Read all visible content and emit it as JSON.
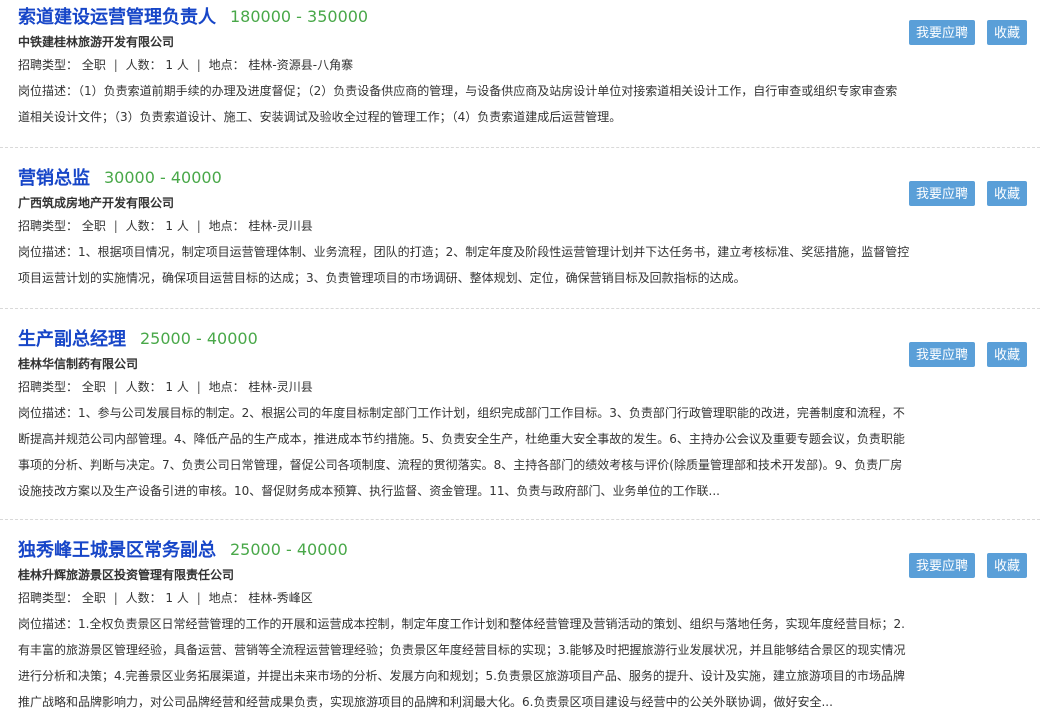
{
  "jobs": [
    {
      "title": "索道建设运营管理负责人",
      "salary": "180000 - 350000",
      "company": "中铁建桂林旅游开发有限公司",
      "type_label": "招聘类型：",
      "type": "全职",
      "count_label": "人数：",
      "count": "1 人",
      "location_label": "地点：",
      "location": "桂林-资源县-八角寨",
      "desc_label": "岗位描述：",
      "desc_lines": [
        "（1）负责索道前期手续的办理及进度督促；（2）负责设备供应商的管理，与设备供应商及站房设计单位对接索道相关设计工作，自行审查或组织专家审查索",
        "道相关设计文件；（3）负责索道设计、施工、安装调试及验收全过程的管理工作；（4）负责索道建成后运营管理。"
      ],
      "apply_label": "我要应聘",
      "fav_label": "收藏"
    },
    {
      "title": "营销总监",
      "salary": "30000 - 40000",
      "company": "广西筑成房地产开发有限公司",
      "type_label": "招聘类型：",
      "type": "全职",
      "count_label": "人数：",
      "count": "1 人",
      "location_label": "地点：",
      "location": "桂林-灵川县",
      "desc_label": "岗位描述：",
      "desc_lines": [
        "1、根据项目情况，制定项目运营管理体制、业务流程，团队的打造；2、制定年度及阶段性运营管理计划并下达任务书，建立考核标准、奖惩措施，监督管控",
        "项目运营计划的实施情况，确保项目运营目标的达成；3、负责管理项目的市场调研、整体规划、定位，确保营销目标及回款指标的达成。"
      ],
      "apply_label": "我要应聘",
      "fav_label": "收藏"
    },
    {
      "title": "生产副总经理",
      "salary": "25000 - 40000",
      "company": "桂林华信制药有限公司",
      "type_label": "招聘类型：",
      "type": "全职",
      "count_label": "人数：",
      "count": "1 人",
      "location_label": "地点：",
      "location": "桂林-灵川县",
      "desc_label": "岗位描述：",
      "desc_lines": [
        "1、参与公司发展目标的制定。2、根据公司的年度目标制定部门工作计划，组织完成部门工作目标。3、负责部门行政管理职能的改进，完善制度和流程，不",
        "断提高并规范公司内部管理。4、降低产品的生产成本，推进成本节约措施。5、负责安全生产，杜绝重大安全事故的发生。6、主持办公会议及重要专题会议，负责职能",
        "事项的分析、判断与决定。7、负责公司日常管理，督促公司各项制度、流程的贯彻落实。8、主持各部门的绩效考核与评价(除质量管理部和技术开发部)。9、负责厂房",
        "设施技改方案以及生产设备引进的审核。10、督促财务成本预算、执行监督、资金管理。11、负责与政府部门、业务单位的工作联..."
      ],
      "apply_label": "我要应聘",
      "fav_label": "收藏"
    },
    {
      "title": "独秀峰王城景区常务副总",
      "salary": "25000 - 40000",
      "company": "桂林升辉旅游景区投资管理有限责任公司",
      "type_label": "招聘类型：",
      "type": "全职",
      "count_label": "人数：",
      "count": "1 人",
      "location_label": "地点：",
      "location": "桂林-秀峰区",
      "desc_label": "岗位描述：",
      "desc_lines": [
        "1.全权负责景区日常经营管理的工作的开展和运营成本控制，制定年度工作计划和整体经营管理及营销活动的策划、组织与落地任务，实现年度经营目标；2.",
        "有丰富的旅游景区管理经验，具备运营、营销等全流程运营管理经验；负责景区年度经营目标的实现；3.能够及时把握旅游行业发展状况，并且能够结合景区的现实情况",
        "进行分析和决策；4.完善景区业务拓展渠道，并提出未来市场的分析、发展方向和规划；5.负责景区旅游项目产品、服务的提升、设计及实施，建立旅游项目的市场品牌",
        "推广战略和品牌影响力，对公司品牌经营和经营成果负责，实现旅游项目的品牌和利润最大化。6.负责景区项目建设与经营中的公关外联协调，做好安全..."
      ],
      "apply_label": "我要应聘",
      "fav_label": "收藏"
    }
  ]
}
